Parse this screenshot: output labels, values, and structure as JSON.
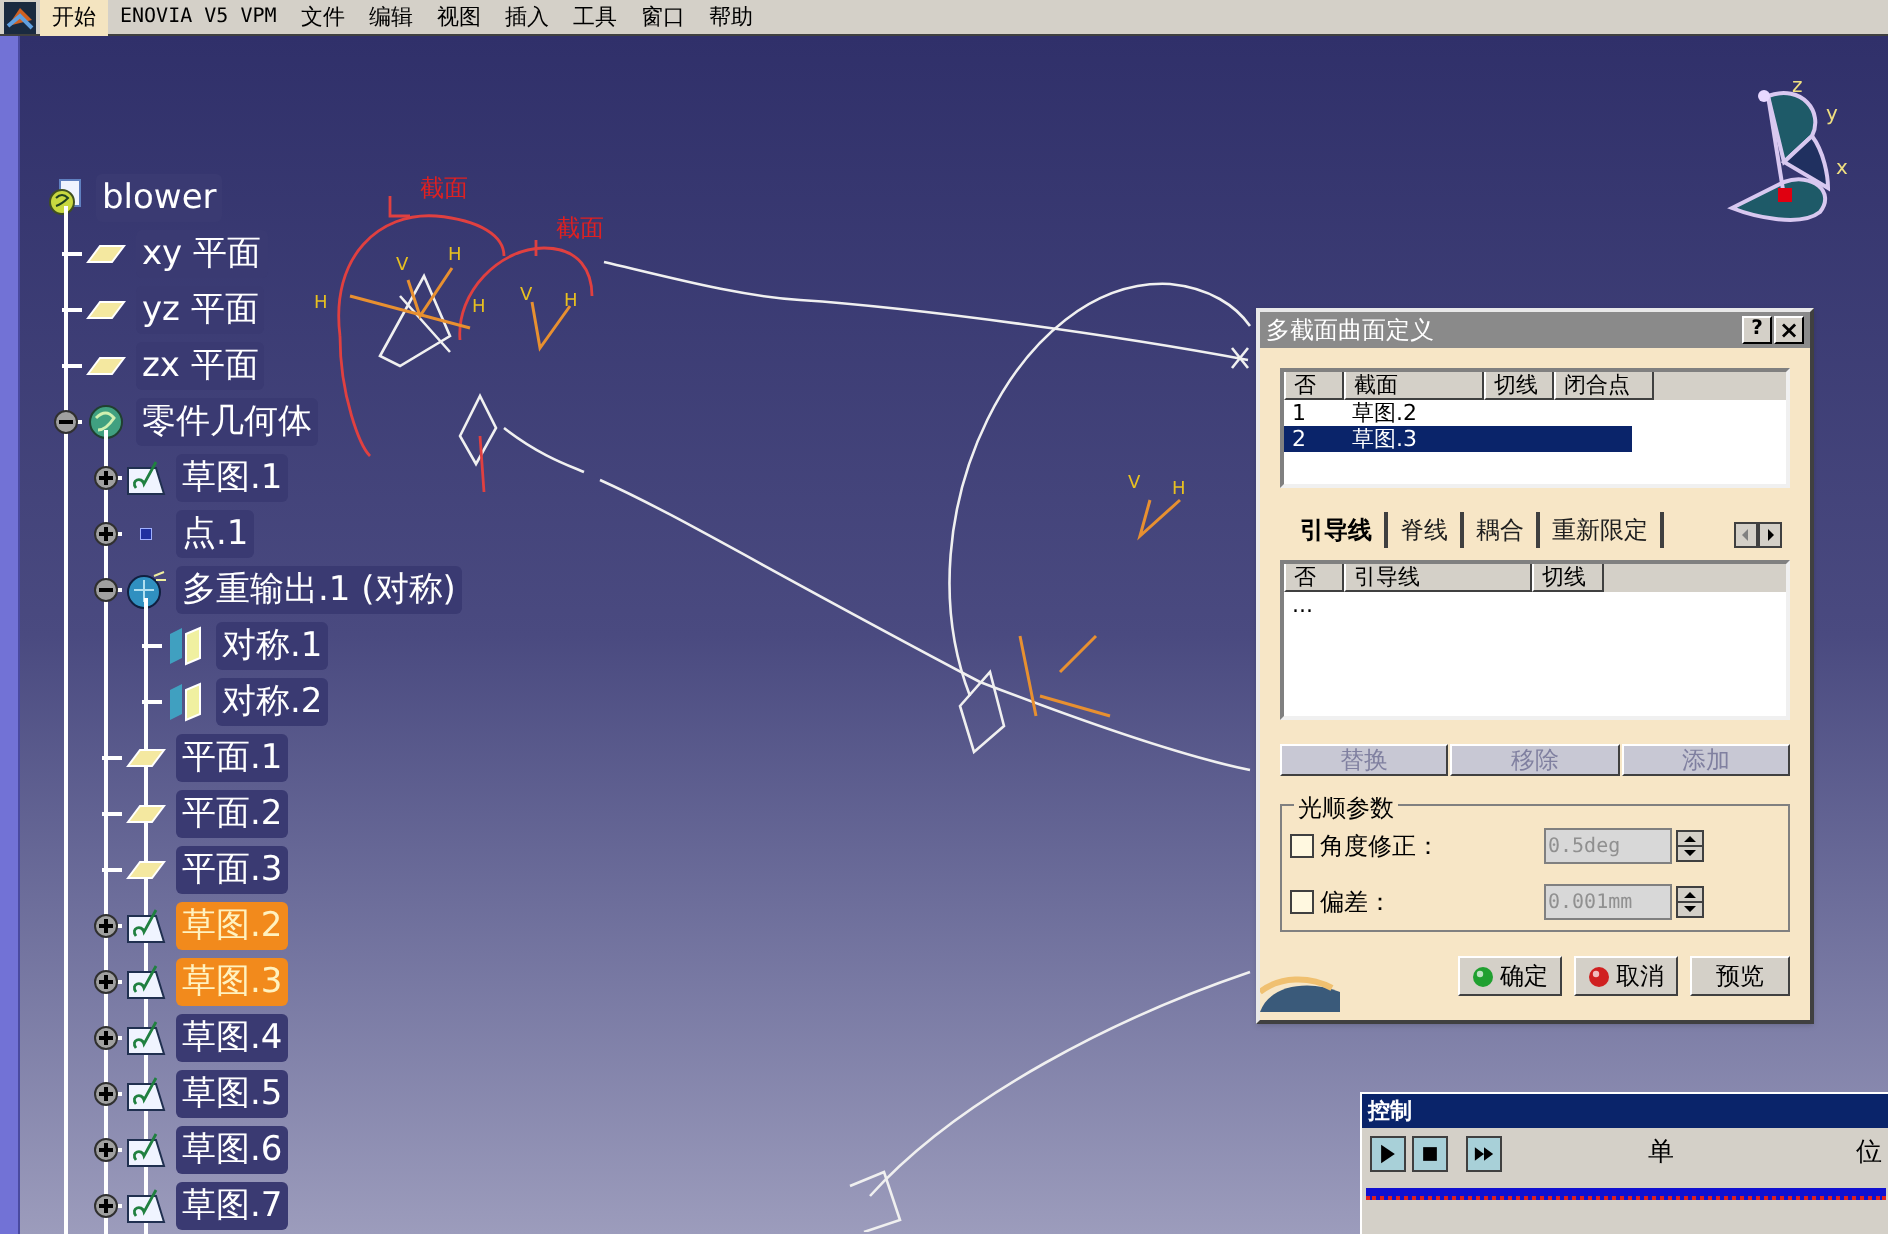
{
  "menu_bar": {
    "items": [
      {
        "label": "开始",
        "selected": true
      },
      {
        "label": "ENOVIA V5 VPM",
        "selected": false
      },
      {
        "label": "文件",
        "selected": false
      },
      {
        "label": "编辑",
        "selected": false
      },
      {
        "label": "视图",
        "selected": false
      },
      {
        "label": "插入",
        "selected": false
      },
      {
        "label": "工具",
        "selected": false
      },
      {
        "label": "窗口",
        "selected": false
      },
      {
        "label": "帮助",
        "selected": false
      }
    ]
  },
  "viewport": {
    "labels": [
      "截面",
      "截面",
      "V",
      "H",
      "H",
      "H",
      "V",
      "H",
      "V",
      "H"
    ]
  },
  "compass": {
    "axes": [
      "z",
      "y",
      "x"
    ]
  },
  "tree": [
    {
      "label": "blower",
      "kind": "part",
      "selected": false,
      "children": [
        {
          "label": "xy 平面",
          "kind": "plane",
          "selected": false
        },
        {
          "label": "yz 平面",
          "kind": "plane",
          "selected": false
        },
        {
          "label": "zx 平面",
          "kind": "plane",
          "selected": false
        },
        {
          "label": "零件几何体",
          "kind": "body",
          "selected": false,
          "expanded": true,
          "children": [
            {
              "label": "草图.1",
              "kind": "sketch",
              "selected": false,
              "expanded": false
            },
            {
              "label": "点.1",
              "kind": "point",
              "selected": false,
              "expanded": false
            },
            {
              "label": "多重输出.1 (对称)",
              "kind": "multi",
              "selected": false,
              "expanded": true,
              "children": [
                {
                  "label": "对称.1",
                  "kind": "symmetry",
                  "selected": false
                },
                {
                  "label": "对称.2",
                  "kind": "symmetry",
                  "selected": false
                }
              ]
            },
            {
              "label": "平面.1",
              "kind": "plane",
              "selected": false
            },
            {
              "label": "平面.2",
              "kind": "plane",
              "selected": false
            },
            {
              "label": "平面.3",
              "kind": "plane",
              "selected": false
            },
            {
              "label": "草图.2",
              "kind": "sketch",
              "selected": true,
              "expanded": false
            },
            {
              "label": "草图.3",
              "kind": "sketch",
              "selected": true,
              "expanded": false
            },
            {
              "label": "草图.4",
              "kind": "sketch",
              "selected": false,
              "expanded": false
            },
            {
              "label": "草图.5",
              "kind": "sketch",
              "selected": false,
              "expanded": false
            },
            {
              "label": "草图.6",
              "kind": "sketch",
              "selected": false,
              "expanded": false
            },
            {
              "label": "草图.7",
              "kind": "sketch",
              "selected": false,
              "expanded": false
            }
          ]
        }
      ]
    }
  ],
  "dialog": {
    "title": "多截面曲面定义",
    "help": "?",
    "close": "×",
    "sections": {
      "columns": [
        "否",
        "截面",
        "切线",
        "闭合点"
      ],
      "rows": [
        {
          "cells": [
            "1",
            "草图.2"
          ],
          "selected": false
        },
        {
          "cells": [
            "2",
            "草图.3"
          ],
          "selected": true
        }
      ]
    },
    "tabs": [
      {
        "label": "引导线",
        "selected": true
      },
      {
        "label": "脊线",
        "selected": false
      },
      {
        "label": "耦合",
        "selected": false
      },
      {
        "label": "重新限定",
        "selected": false
      }
    ],
    "guides": {
      "columns": [
        "否",
        "引导线",
        "切线"
      ],
      "rows": [
        {
          "cells": [
            "..."
          ]
        }
      ]
    },
    "list_buttons": [
      {
        "label": "替换",
        "disabled": true
      },
      {
        "label": "移除",
        "disabled": true
      },
      {
        "label": "添加",
        "disabled": true
      }
    ],
    "smoothing": {
      "title": "光顺参数",
      "options": [
        {
          "label": "角度修正：",
          "checked": false,
          "value": "0.5deg",
          "disabled": true
        },
        {
          "label": "偏差：",
          "checked": false,
          "value": "0.001mm",
          "disabled": true
        }
      ]
    },
    "buttons": [
      {
        "label": "确定",
        "kind": "ok"
      },
      {
        "label": "取消",
        "kind": "cancel"
      },
      {
        "label": "预览",
        "kind": "plain"
      }
    ]
  },
  "control_panel": {
    "title": "控制",
    "texts": [
      "单",
      "位"
    ]
  }
}
